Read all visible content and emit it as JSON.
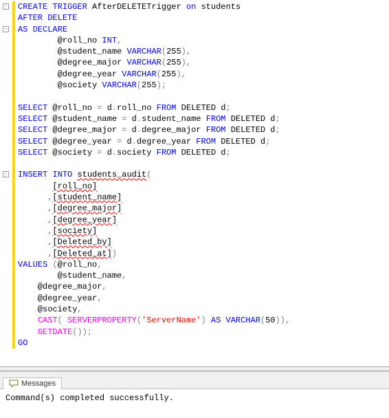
{
  "code_lines": [
    {
      "fold": true,
      "segs": [
        {
          "c": "kw",
          "t": "CREATE"
        },
        {
          "t": " "
        },
        {
          "c": "kw",
          "t": "TRIGGER"
        },
        {
          "t": " AfterDELETETrigger "
        },
        {
          "c": "kw",
          "t": "on"
        },
        {
          "t": " students"
        }
      ]
    },
    {
      "segs": [
        {
          "c": "kw",
          "t": "AFTER"
        },
        {
          "t": " "
        },
        {
          "c": "kw",
          "t": "DELETE"
        }
      ]
    },
    {
      "fold": true,
      "segs": [
        {
          "c": "kw",
          "t": "AS"
        },
        {
          "t": " "
        },
        {
          "c": "kw",
          "t": "DECLARE"
        }
      ]
    },
    {
      "segs": [
        {
          "t": "        @roll_no "
        },
        {
          "c": "kw",
          "t": "INT"
        },
        {
          "c": "gray",
          "t": ","
        }
      ]
    },
    {
      "segs": [
        {
          "t": "        @student_name "
        },
        {
          "c": "kw",
          "t": "VARCHAR"
        },
        {
          "c": "gray",
          "t": "("
        },
        {
          "t": "255"
        },
        {
          "c": "gray",
          "t": "),"
        }
      ]
    },
    {
      "segs": [
        {
          "t": "        @degree_major "
        },
        {
          "c": "kw",
          "t": "VARCHAR"
        },
        {
          "c": "gray",
          "t": "("
        },
        {
          "t": "255"
        },
        {
          "c": "gray",
          "t": "),"
        }
      ]
    },
    {
      "segs": [
        {
          "t": "        @degree_year "
        },
        {
          "c": "kw",
          "t": "VARCHAR"
        },
        {
          "c": "gray",
          "t": "("
        },
        {
          "t": "255"
        },
        {
          "c": "gray",
          "t": "),"
        }
      ]
    },
    {
      "segs": [
        {
          "t": "        @society "
        },
        {
          "c": "kw",
          "t": "VARCHAR"
        },
        {
          "c": "gray",
          "t": "("
        },
        {
          "t": "255"
        },
        {
          "c": "gray",
          "t": ");"
        }
      ]
    },
    {
      "segs": [
        {
          "t": " "
        }
      ]
    },
    {
      "segs": [
        {
          "c": "kw",
          "t": "SELECT"
        },
        {
          "t": " @roll_no "
        },
        {
          "c": "gray",
          "t": "="
        },
        {
          "t": " d"
        },
        {
          "c": "gray",
          "t": "."
        },
        {
          "t": "roll_no "
        },
        {
          "c": "kw",
          "t": "FROM"
        },
        {
          "t": " DELETED d"
        },
        {
          "c": "gray",
          "t": ";"
        }
      ]
    },
    {
      "segs": [
        {
          "c": "kw",
          "t": "SELECT"
        },
        {
          "t": " @student_name "
        },
        {
          "c": "gray",
          "t": "="
        },
        {
          "t": " d"
        },
        {
          "c": "gray",
          "t": "."
        },
        {
          "t": "student_name "
        },
        {
          "c": "kw",
          "t": "FROM"
        },
        {
          "t": " DELETED d"
        },
        {
          "c": "gray",
          "t": ";"
        }
      ]
    },
    {
      "segs": [
        {
          "c": "kw",
          "t": "SELECT"
        },
        {
          "t": " @degree_major "
        },
        {
          "c": "gray",
          "t": "="
        },
        {
          "t": " d"
        },
        {
          "c": "gray",
          "t": "."
        },
        {
          "t": "degree_major "
        },
        {
          "c": "kw",
          "t": "FROM"
        },
        {
          "t": " DELETED d"
        },
        {
          "c": "gray",
          "t": ";"
        }
      ]
    },
    {
      "segs": [
        {
          "c": "kw",
          "t": "SELECT"
        },
        {
          "t": " @degree_year "
        },
        {
          "c": "gray",
          "t": "="
        },
        {
          "t": " d"
        },
        {
          "c": "gray",
          "t": "."
        },
        {
          "t": "degree_year "
        },
        {
          "c": "kw",
          "t": "FROM"
        },
        {
          "t": " DELETED d"
        },
        {
          "c": "gray",
          "t": ";"
        }
      ]
    },
    {
      "segs": [
        {
          "c": "kw",
          "t": "SELECT"
        },
        {
          "t": " @society "
        },
        {
          "c": "gray",
          "t": "="
        },
        {
          "t": " d"
        },
        {
          "c": "gray",
          "t": "."
        },
        {
          "t": "society "
        },
        {
          "c": "kw",
          "t": "FROM"
        },
        {
          "t": " DELETED d"
        },
        {
          "c": "gray",
          "t": ";"
        }
      ]
    },
    {
      "segs": [
        {
          "t": " "
        }
      ]
    },
    {
      "fold": true,
      "segs": [
        {
          "c": "kw",
          "t": "INSERT"
        },
        {
          "t": " "
        },
        {
          "c": "kw",
          "t": "INTO"
        },
        {
          "t": " "
        },
        {
          "c": "err",
          "t": "students_audit"
        },
        {
          "c": "gray",
          "t": "("
        }
      ]
    },
    {
      "segs": [
        {
          "t": "       "
        },
        {
          "c": "err",
          "t": "[roll_no]"
        }
      ]
    },
    {
      "segs": [
        {
          "t": "      "
        },
        {
          "c": "gray",
          "t": ","
        },
        {
          "c": "err",
          "t": "[student_name]"
        }
      ]
    },
    {
      "segs": [
        {
          "t": "      "
        },
        {
          "c": "gray",
          "t": ","
        },
        {
          "c": "err",
          "t": "[degree_major]"
        }
      ]
    },
    {
      "segs": [
        {
          "t": "      "
        },
        {
          "c": "gray",
          "t": ","
        },
        {
          "c": "err",
          "t": "[degree_year]"
        }
      ]
    },
    {
      "segs": [
        {
          "t": "      "
        },
        {
          "c": "gray",
          "t": ","
        },
        {
          "c": "err",
          "t": "[society]"
        }
      ]
    },
    {
      "segs": [
        {
          "t": "      "
        },
        {
          "c": "gray",
          "t": ","
        },
        {
          "c": "err",
          "t": "[Deleted_by]"
        }
      ]
    },
    {
      "segs": [
        {
          "t": "      "
        },
        {
          "c": "gray",
          "t": ","
        },
        {
          "c": "err",
          "t": "[Deleted_at]"
        },
        {
          "c": "gray",
          "t": ")"
        }
      ]
    },
    {
      "segs": [
        {
          "c": "kw",
          "t": "VALUES"
        },
        {
          "t": " "
        },
        {
          "c": "gray",
          "t": "("
        },
        {
          "t": "@roll_no"
        },
        {
          "c": "gray",
          "t": ","
        }
      ]
    },
    {
      "segs": [
        {
          "t": "        @student_name"
        },
        {
          "c": "gray",
          "t": ","
        }
      ]
    },
    {
      "segs": [
        {
          "t": "    @degree_major"
        },
        {
          "c": "gray",
          "t": ","
        }
      ]
    },
    {
      "segs": [
        {
          "t": "    @degree_year"
        },
        {
          "c": "gray",
          "t": ","
        }
      ]
    },
    {
      "segs": [
        {
          "t": "    @society"
        },
        {
          "c": "gray",
          "t": ","
        }
      ]
    },
    {
      "segs": [
        {
          "t": "    "
        },
        {
          "c": "fn",
          "t": "CAST"
        },
        {
          "c": "gray",
          "t": "("
        },
        {
          "t": " "
        },
        {
          "c": "fn",
          "t": "SERVERPROPERTY"
        },
        {
          "c": "gray",
          "t": "("
        },
        {
          "c": "str",
          "t": "'ServerName'"
        },
        {
          "c": "gray",
          "t": ")"
        },
        {
          "t": " "
        },
        {
          "c": "kw",
          "t": "AS"
        },
        {
          "t": " "
        },
        {
          "c": "kw",
          "t": "VARCHAR"
        },
        {
          "c": "gray",
          "t": "("
        },
        {
          "t": "50"
        },
        {
          "c": "gray",
          "t": ")),"
        }
      ]
    },
    {
      "segs": [
        {
          "t": "    "
        },
        {
          "c": "fn",
          "t": "GETDATE"
        },
        {
          "c": "gray",
          "t": "());"
        }
      ]
    },
    {
      "segs": [
        {
          "c": "kw",
          "t": "GO"
        }
      ]
    }
  ],
  "results": {
    "tab_label": "Messages",
    "message": "Command(s) completed successfully."
  }
}
